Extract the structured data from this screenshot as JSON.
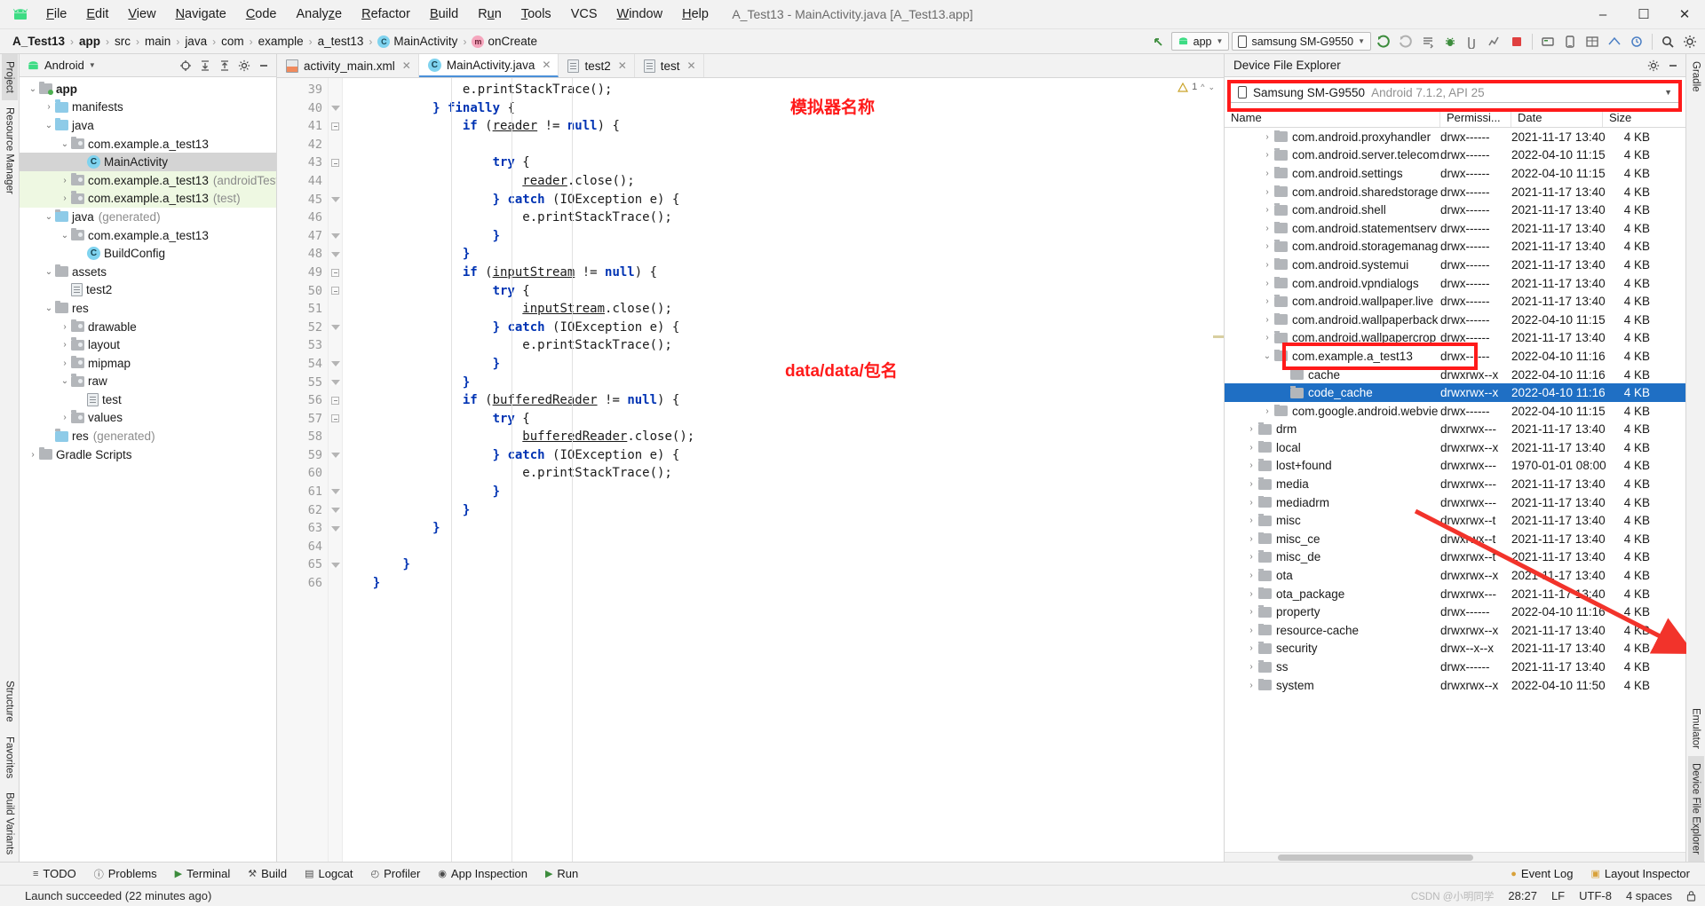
{
  "window": {
    "title": "A_Test13 - MainActivity.java [A_Test13.app]",
    "minimize": "—",
    "maximize": "▢",
    "close": "✕"
  },
  "menu": {
    "logo": "android-robot-icon",
    "items": [
      "File",
      "Edit",
      "View",
      "Navigate",
      "Code",
      "Analyze",
      "Refactor",
      "Build",
      "Run",
      "Tools",
      "VCS",
      "Window",
      "Help"
    ]
  },
  "breadcrumb": {
    "items": [
      {
        "label": "A_Test13",
        "bold": true,
        "icon": null
      },
      {
        "label": "app",
        "bold": true,
        "icon": null
      },
      {
        "label": "src",
        "bold": false,
        "icon": null
      },
      {
        "label": "main",
        "bold": false,
        "icon": null
      },
      {
        "label": "java",
        "bold": false,
        "icon": null
      },
      {
        "label": "com",
        "bold": false,
        "icon": null
      },
      {
        "label": "example",
        "bold": false,
        "icon": null
      },
      {
        "label": "a_test13",
        "bold": false,
        "icon": null
      },
      {
        "label": "MainActivity",
        "bold": false,
        "icon": "class-icon",
        "icon_letter": "C"
      },
      {
        "label": "onCreate",
        "bold": false,
        "icon": "method-icon",
        "icon_letter": "m"
      }
    ],
    "separator": "›"
  },
  "toolbar": {
    "run_config": "app",
    "device": "samsung SM-G9550",
    "caret": "▼",
    "icons": [
      "back-arrow-icon",
      "sync-gradle-icon",
      "avd-manager-icon",
      "make-project-icon",
      "debug-icon",
      "attach-debugger-icon",
      "profiler-icon",
      "stop-icon",
      "sdk-manager-icon",
      "layout-inspector-icon",
      "device-manager-icon",
      "search-icon"
    ]
  },
  "left_strip": {
    "tabs": [
      "Project",
      "Resource Manager"
    ],
    "bottom_tabs": [
      "Structure",
      "Favorites",
      "Build Variants"
    ]
  },
  "right_strip": {
    "tabs": [
      "Gradle",
      "Emulator",
      "Device File Explorer"
    ]
  },
  "project_panel": {
    "title": "Android",
    "title_caret": "▼",
    "actions": [
      "target-icon",
      "expand-all-icon",
      "collapse-all-icon",
      "settings-icon",
      "hide-icon"
    ],
    "tree": [
      {
        "indent": 0,
        "arrow": "⌄",
        "icon": "module-folder",
        "label": "app",
        "bold": true,
        "dim": "",
        "state": ""
      },
      {
        "indent": 1,
        "arrow": "›",
        "icon": "blue-folder",
        "label": "manifests",
        "bold": false,
        "dim": "",
        "state": ""
      },
      {
        "indent": 1,
        "arrow": "⌄",
        "icon": "blue-folder",
        "label": "java",
        "bold": false,
        "dim": "",
        "state": ""
      },
      {
        "indent": 2,
        "arrow": "⌄",
        "icon": "package-folder",
        "label": "com.example.a_test13",
        "bold": false,
        "dim": "",
        "state": ""
      },
      {
        "indent": 3,
        "arrow": "",
        "icon": "class-icon",
        "label": "MainActivity",
        "bold": false,
        "dim": "",
        "state": "sel"
      },
      {
        "indent": 2,
        "arrow": "›",
        "icon": "package-folder",
        "label": "com.example.a_test13",
        "bold": false,
        "dim": "(androidTest)",
        "state": "green"
      },
      {
        "indent": 2,
        "arrow": "›",
        "icon": "package-folder",
        "label": "com.example.a_test13",
        "bold": false,
        "dim": "(test)",
        "state": "green"
      },
      {
        "indent": 1,
        "arrow": "⌄",
        "icon": "generated-folder",
        "label": "java",
        "bold": false,
        "dim": "(generated)",
        "state": ""
      },
      {
        "indent": 2,
        "arrow": "⌄",
        "icon": "package-folder",
        "label": "com.example.a_test13",
        "bold": false,
        "dim": "",
        "state": ""
      },
      {
        "indent": 3,
        "arrow": "",
        "icon": "class-icon",
        "label": "BuildConfig",
        "bold": false,
        "dim": "",
        "state": ""
      },
      {
        "indent": 1,
        "arrow": "⌄",
        "icon": "res-folder",
        "label": "assets",
        "bold": false,
        "dim": "",
        "state": ""
      },
      {
        "indent": 2,
        "arrow": "",
        "icon": "file-icon",
        "label": "test2",
        "bold": false,
        "dim": "",
        "state": ""
      },
      {
        "indent": 1,
        "arrow": "⌄",
        "icon": "res-folder",
        "label": "res",
        "bold": false,
        "dim": "",
        "state": ""
      },
      {
        "indent": 2,
        "arrow": "›",
        "icon": "package-folder",
        "label": "drawable",
        "bold": false,
        "dim": "",
        "state": ""
      },
      {
        "indent": 2,
        "arrow": "›",
        "icon": "package-folder",
        "label": "layout",
        "bold": false,
        "dim": "",
        "state": ""
      },
      {
        "indent": 2,
        "arrow": "›",
        "icon": "package-folder",
        "label": "mipmap",
        "bold": false,
        "dim": "",
        "state": ""
      },
      {
        "indent": 2,
        "arrow": "⌄",
        "icon": "package-folder",
        "label": "raw",
        "bold": false,
        "dim": "",
        "state": ""
      },
      {
        "indent": 3,
        "arrow": "",
        "icon": "file-icon",
        "label": "test",
        "bold": false,
        "dim": "",
        "state": ""
      },
      {
        "indent": 2,
        "arrow": "›",
        "icon": "package-folder",
        "label": "values",
        "bold": false,
        "dim": "",
        "state": ""
      },
      {
        "indent": 1,
        "arrow": "",
        "icon": "generated-folder",
        "label": "res",
        "bold": false,
        "dim": "(generated)",
        "state": ""
      },
      {
        "indent": 0,
        "arrow": "›",
        "icon": "gradle-icon",
        "label": "Gradle Scripts",
        "bold": false,
        "dim": "",
        "state": ""
      }
    ]
  },
  "editor": {
    "tabs": [
      {
        "label": "activity_main.xml",
        "icon": "xml-file-icon",
        "active": false,
        "close": "✕"
      },
      {
        "label": "MainActivity.java",
        "icon": "java-class-icon",
        "active": true,
        "close": "✕"
      },
      {
        "label": "test2",
        "icon": "file-icon",
        "active": false,
        "close": "✕"
      },
      {
        "label": "test",
        "icon": "file-icon",
        "active": false,
        "close": "✕"
      }
    ],
    "first_line": 39,
    "lines": [
      {
        "n": 39,
        "fold": "",
        "text": "                e.printStackTrace();"
      },
      {
        "n": 40,
        "fold": "tri",
        "text": "            } finally {"
      },
      {
        "n": 41,
        "fold": "dash",
        "text": "                if (reader != null) {"
      },
      {
        "n": 42,
        "fold": "",
        "text": ""
      },
      {
        "n": 43,
        "fold": "dash",
        "text": "                    try {"
      },
      {
        "n": 44,
        "fold": "",
        "text": "                        reader.close();"
      },
      {
        "n": 45,
        "fold": "tri",
        "text": "                    } catch (IOException e) {"
      },
      {
        "n": 46,
        "fold": "",
        "text": "                        e.printStackTrace();"
      },
      {
        "n": 47,
        "fold": "tri",
        "text": "                    }"
      },
      {
        "n": 48,
        "fold": "tri",
        "text": "                }"
      },
      {
        "n": 49,
        "fold": "dash",
        "text": "                if (inputStream != null) {"
      },
      {
        "n": 50,
        "fold": "dash",
        "text": "                    try {"
      },
      {
        "n": 51,
        "fold": "",
        "text": "                        inputStream.close();"
      },
      {
        "n": 52,
        "fold": "tri",
        "text": "                    } catch (IOException e) {"
      },
      {
        "n": 53,
        "fold": "",
        "text": "                        e.printStackTrace();"
      },
      {
        "n": 54,
        "fold": "tri",
        "text": "                    }"
      },
      {
        "n": 55,
        "fold": "tri",
        "text": "                }"
      },
      {
        "n": 56,
        "fold": "dash",
        "text": "                if (bufferedReader != null) {"
      },
      {
        "n": 57,
        "fold": "dash",
        "text": "                    try {"
      },
      {
        "n": 58,
        "fold": "",
        "text": "                        bufferedReader.close();"
      },
      {
        "n": 59,
        "fold": "tri",
        "text": "                    } catch (IOException e) {"
      },
      {
        "n": 60,
        "fold": "",
        "text": "                        e.printStackTrace();"
      },
      {
        "n": 61,
        "fold": "tri",
        "text": "                    }"
      },
      {
        "n": 62,
        "fold": "tri",
        "text": "                }"
      },
      {
        "n": 63,
        "fold": "tri",
        "text": "            }"
      },
      {
        "n": 64,
        "fold": "",
        "text": ""
      },
      {
        "n": 65,
        "fold": "tri",
        "text": "        }"
      },
      {
        "n": 66,
        "fold": "",
        "text": "    }"
      }
    ],
    "warning_count": "1"
  },
  "device_file_explorer": {
    "title": "Device File Explorer",
    "actions": [
      "settings-icon",
      "hide-icon"
    ],
    "device": {
      "name": "Samsung SM-G9550",
      "os": "Android 7.1.2, API 25",
      "caret": "▼"
    },
    "columns": [
      "Name",
      "Permissi...",
      "Date",
      "Size"
    ],
    "rows": [
      {
        "indent": 2,
        "arrow": "›",
        "name": "com.android.proxyhandler",
        "perm": "drwx------",
        "date": "2021-11-17 13:40",
        "size": "4 KB",
        "sel": false
      },
      {
        "indent": 2,
        "arrow": "›",
        "name": "com.android.server.telecom",
        "perm": "drwx------",
        "date": "2022-04-10 11:15",
        "size": "4 KB",
        "sel": false
      },
      {
        "indent": 2,
        "arrow": "›",
        "name": "com.android.settings",
        "perm": "drwx------",
        "date": "2022-04-10 11:15",
        "size": "4 KB",
        "sel": false
      },
      {
        "indent": 2,
        "arrow": "›",
        "name": "com.android.sharedstorage",
        "perm": "drwx------",
        "date": "2021-11-17 13:40",
        "size": "4 KB",
        "sel": false
      },
      {
        "indent": 2,
        "arrow": "›",
        "name": "com.android.shell",
        "perm": "drwx------",
        "date": "2021-11-17 13:40",
        "size": "4 KB",
        "sel": false
      },
      {
        "indent": 2,
        "arrow": "›",
        "name": "com.android.statementserv",
        "perm": "drwx------",
        "date": "2021-11-17 13:40",
        "size": "4 KB",
        "sel": false
      },
      {
        "indent": 2,
        "arrow": "›",
        "name": "com.android.storagemanag",
        "perm": "drwx------",
        "date": "2021-11-17 13:40",
        "size": "4 KB",
        "sel": false
      },
      {
        "indent": 2,
        "arrow": "›",
        "name": "com.android.systemui",
        "perm": "drwx------",
        "date": "2021-11-17 13:40",
        "size": "4 KB",
        "sel": false
      },
      {
        "indent": 2,
        "arrow": "›",
        "name": "com.android.vpndialogs",
        "perm": "drwx------",
        "date": "2021-11-17 13:40",
        "size": "4 KB",
        "sel": false
      },
      {
        "indent": 2,
        "arrow": "›",
        "name": "com.android.wallpaper.live",
        "perm": "drwx------",
        "date": "2021-11-17 13:40",
        "size": "4 KB",
        "sel": false
      },
      {
        "indent": 2,
        "arrow": "›",
        "name": "com.android.wallpaperback",
        "perm": "drwx------",
        "date": "2022-04-10 11:15",
        "size": "4 KB",
        "sel": false
      },
      {
        "indent": 2,
        "arrow": "›",
        "name": "com.android.wallpapercrop",
        "perm": "drwx------",
        "date": "2021-11-17 13:40",
        "size": "4 KB",
        "sel": false
      },
      {
        "indent": 2,
        "arrow": "⌄",
        "name": "com.example.a_test13",
        "perm": "drwx------",
        "date": "2022-04-10 11:16",
        "size": "4 KB",
        "sel": false
      },
      {
        "indent": 3,
        "arrow": "",
        "name": "cache",
        "perm": "drwxrwx--x",
        "date": "2022-04-10 11:16",
        "size": "4 KB",
        "sel": false
      },
      {
        "indent": 3,
        "arrow": "",
        "name": "code_cache",
        "perm": "drwxrwx--x",
        "date": "2022-04-10 11:16",
        "size": "4 KB",
        "sel": true
      },
      {
        "indent": 2,
        "arrow": "›",
        "name": "com.google.android.webvie",
        "perm": "drwx------",
        "date": "2022-04-10 11:15",
        "size": "4 KB",
        "sel": false
      },
      {
        "indent": 1,
        "arrow": "›",
        "name": "drm",
        "perm": "drwxrwx---",
        "date": "2021-11-17 13:40",
        "size": "4 KB",
        "sel": false
      },
      {
        "indent": 1,
        "arrow": "›",
        "name": "local",
        "perm": "drwxrwx--x",
        "date": "2021-11-17 13:40",
        "size": "4 KB",
        "sel": false
      },
      {
        "indent": 1,
        "arrow": "›",
        "name": "lost+found",
        "perm": "drwxrwx---",
        "date": "1970-01-01 08:00",
        "size": "4 KB",
        "sel": false
      },
      {
        "indent": 1,
        "arrow": "›",
        "name": "media",
        "perm": "drwxrwx---",
        "date": "2021-11-17 13:40",
        "size": "4 KB",
        "sel": false
      },
      {
        "indent": 1,
        "arrow": "›",
        "name": "mediadrm",
        "perm": "drwxrwx---",
        "date": "2021-11-17 13:40",
        "size": "4 KB",
        "sel": false
      },
      {
        "indent": 1,
        "arrow": "›",
        "name": "misc",
        "perm": "drwxrwx--t",
        "date": "2021-11-17 13:40",
        "size": "4 KB",
        "sel": false
      },
      {
        "indent": 1,
        "arrow": "›",
        "name": "misc_ce",
        "perm": "drwxrwx--t",
        "date": "2021-11-17 13:40",
        "size": "4 KB",
        "sel": false
      },
      {
        "indent": 1,
        "arrow": "›",
        "name": "misc_de",
        "perm": "drwxrwx--t",
        "date": "2021-11-17 13:40",
        "size": "4 KB",
        "sel": false
      },
      {
        "indent": 1,
        "arrow": "›",
        "name": "ota",
        "perm": "drwxrwx--x",
        "date": "2021-11-17 13:40",
        "size": "4 KB",
        "sel": false
      },
      {
        "indent": 1,
        "arrow": "›",
        "name": "ota_package",
        "perm": "drwxrwx---",
        "date": "2021-11-17 13:40",
        "size": "4 KB",
        "sel": false
      },
      {
        "indent": 1,
        "arrow": "›",
        "name": "property",
        "perm": "drwx------",
        "date": "2022-04-10 11:16",
        "size": "4 KB",
        "sel": false
      },
      {
        "indent": 1,
        "arrow": "›",
        "name": "resource-cache",
        "perm": "drwxrwx--x",
        "date": "2021-11-17 13:40",
        "size": "4 KB",
        "sel": false
      },
      {
        "indent": 1,
        "arrow": "›",
        "name": "security",
        "perm": "drwx--x--x",
        "date": "2021-11-17 13:40",
        "size": "4 KB",
        "sel": false
      },
      {
        "indent": 1,
        "arrow": "›",
        "name": "ss",
        "perm": "drwx------",
        "date": "2021-11-17 13:40",
        "size": "4 KB",
        "sel": false
      },
      {
        "indent": 1,
        "arrow": "›",
        "name": "system",
        "perm": "drwxrwx--x",
        "date": "2022-04-10 11:50",
        "size": "4 KB",
        "sel": false
      }
    ]
  },
  "annotations": {
    "emulator_name": "模拟器名称",
    "data_path": "data/data/包名"
  },
  "bottom_tools": {
    "items": [
      {
        "label": "TODO",
        "icon": "todo-icon"
      },
      {
        "label": "Problems",
        "icon": "problems-icon"
      },
      {
        "label": "Terminal",
        "icon": "terminal-icon"
      },
      {
        "label": "Build",
        "icon": "build-icon"
      },
      {
        "label": "Logcat",
        "icon": "logcat-icon"
      },
      {
        "label": "Profiler",
        "icon": "profiler-icon"
      },
      {
        "label": "App Inspection",
        "icon": "app-inspection-icon"
      },
      {
        "label": "Run",
        "icon": "run-icon"
      }
    ],
    "right_items": [
      {
        "label": "Event Log",
        "icon": "event-log-icon"
      },
      {
        "label": "Layout Inspector",
        "icon": "layout-inspector-icon"
      }
    ]
  },
  "status_bar": {
    "message": "Launch succeeded (22 minutes ago)",
    "caret_position": "28:27",
    "line_separator": "LF",
    "encoding": "UTF-8",
    "indent": "4 spaces",
    "watermark": "CSDN @小明同学"
  },
  "colors": {
    "accent_blue": "#1f6fc4",
    "annotation_red": "#ff1a1a",
    "android_green": "#3ddc84",
    "keyword_blue": "#0033b3"
  }
}
